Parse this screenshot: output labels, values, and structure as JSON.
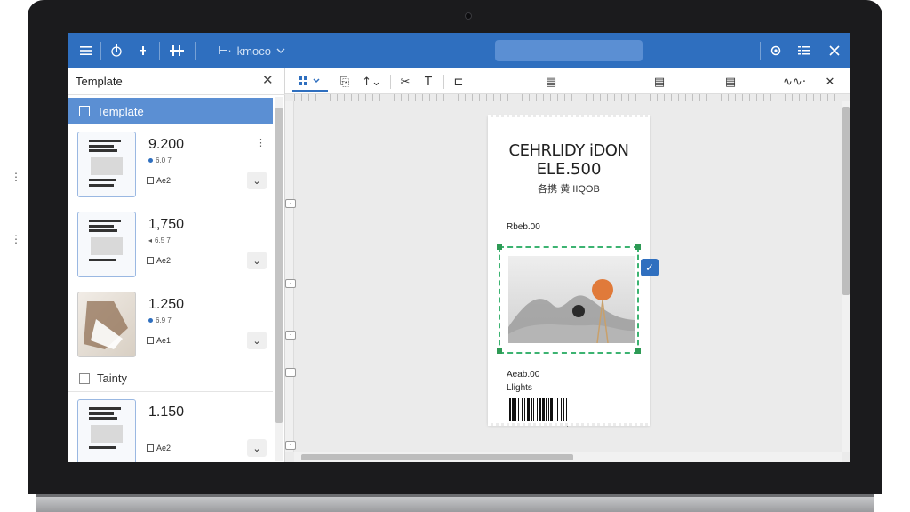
{
  "titlebar": {
    "menu_label": "kmoco",
    "icons": [
      "menu-icon",
      "touch-icon",
      "add-icon",
      "align-icon",
      "settings-icon",
      "list-icon",
      "close-icon"
    ]
  },
  "left_panel": {
    "title": "Template",
    "groups": [
      {
        "label": "Template",
        "selected": true
      },
      {
        "label": "Tainty",
        "selected": false
      }
    ],
    "cards": [
      {
        "price": "9.200",
        "sub": "6.0 7",
        "meta": "Ae2"
      },
      {
        "price": "1,750",
        "sub": "6.5 7",
        "meta": "Ae2"
      },
      {
        "price": "1.250",
        "sub": "6.9 7",
        "meta": "Ae1"
      },
      {
        "price": "1.150",
        "sub": "",
        "meta": "Ae2"
      }
    ]
  },
  "receipt": {
    "title": "CEHRLIDY iDON",
    "price": "ELE.500",
    "line3": "各携 黄 IIQOB",
    "rate": "Rbeb.00",
    "amount": "Aeab.00",
    "lights": "Llights"
  },
  "colors": {
    "accent": "#2f6fbf",
    "selection": "#5b8fd3",
    "dashed_border": "#3cb371"
  }
}
